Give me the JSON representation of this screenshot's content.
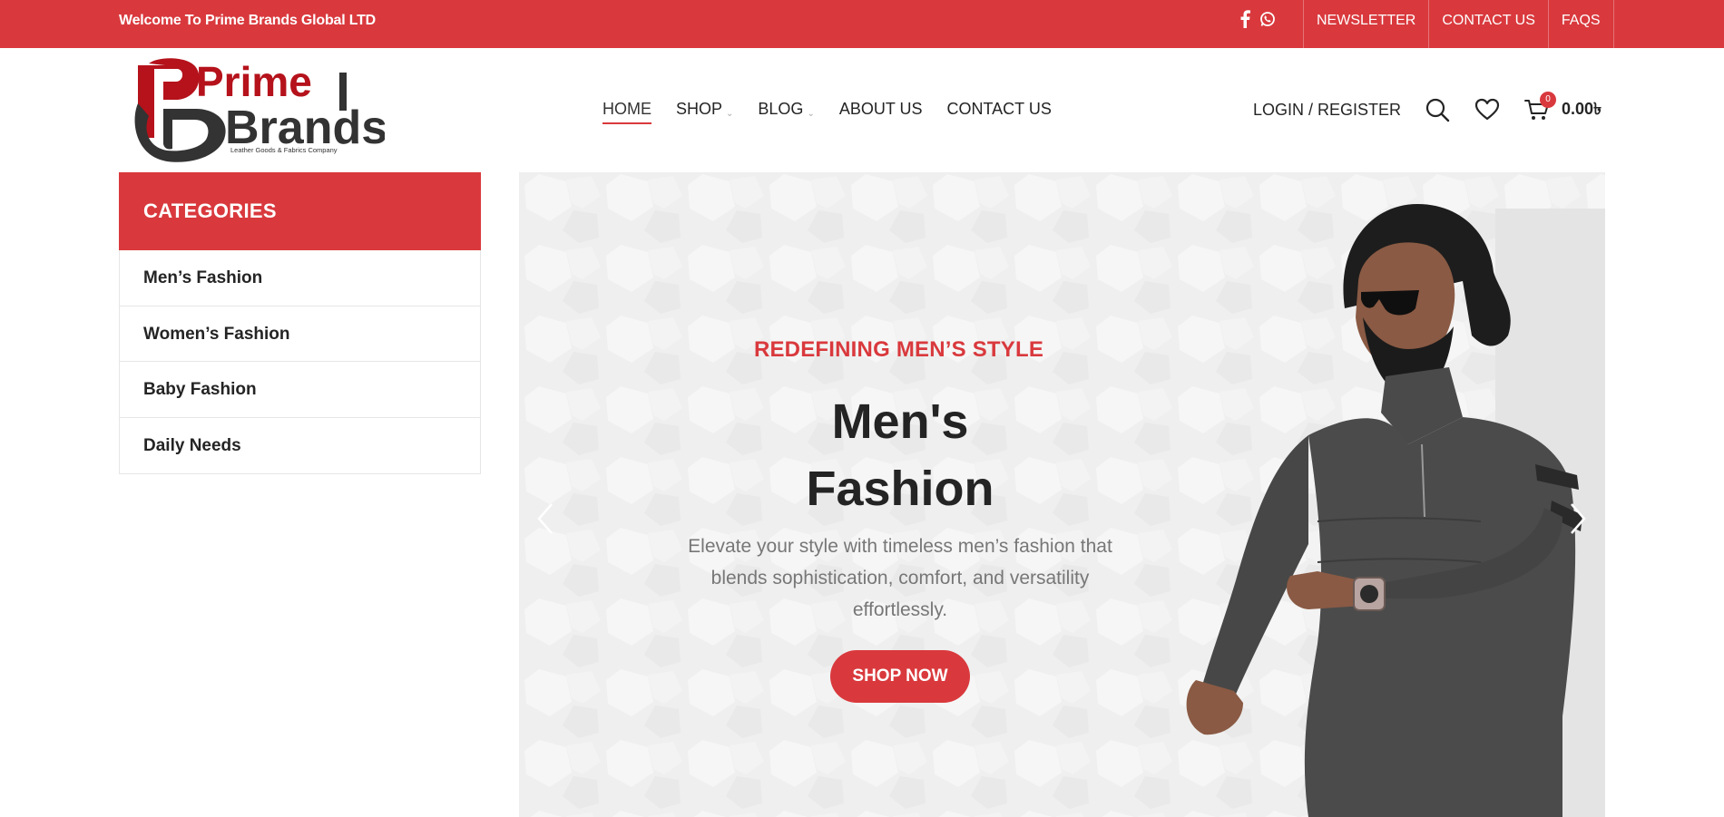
{
  "topbar": {
    "welcome": "Welcome To Prime Brands Global LTD",
    "social_icons": [
      "facebook-icon",
      "whatsapp-icon"
    ],
    "links": [
      "NEWSLETTER",
      "CONTACT US",
      "FAQS"
    ]
  },
  "logo": {
    "line1": "Prime",
    "line2": "Brands",
    "tagline": "Leather Goods & Fabrics Company"
  },
  "nav": {
    "items": [
      {
        "label": "HOME",
        "active": true,
        "dropdown": false
      },
      {
        "label": "SHOP",
        "active": false,
        "dropdown": true
      },
      {
        "label": "BLOG",
        "active": false,
        "dropdown": true
      },
      {
        "label": "ABOUT US",
        "active": false,
        "dropdown": false
      },
      {
        "label": "CONTACT US",
        "active": false,
        "dropdown": false
      }
    ]
  },
  "header_right": {
    "login": "LOGIN / REGISTER",
    "icons": [
      "search-icon",
      "heart-icon",
      "cart-icon"
    ],
    "cart_count": "0",
    "cart_total": "0.00৳"
  },
  "categories": {
    "title": "CATEGORIES",
    "items": [
      "Men’s Fashion",
      "Women’s Fashion",
      "Baby Fashion",
      "Daily Needs"
    ]
  },
  "hero": {
    "subtitle": "REDEFINING MEN’S STYLE",
    "title_line1": "Men's",
    "title_line2": "Fashion",
    "description": "Elevate your style with timeless men’s fashion that blends sophistication, comfort, and versatility effortlessly.",
    "button": "SHOP NOW"
  },
  "colors": {
    "accent": "#d9393d",
    "text": "#242424",
    "muted": "#777777",
    "hero_bg": "#efefef"
  }
}
